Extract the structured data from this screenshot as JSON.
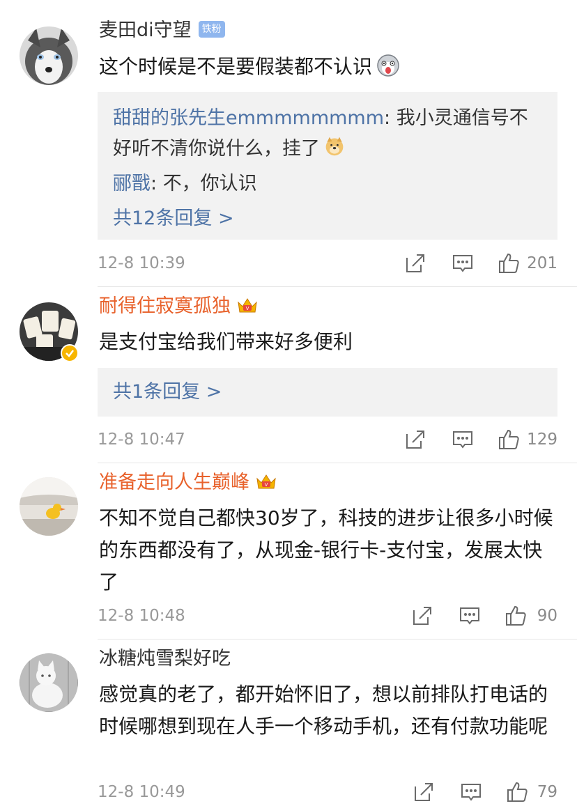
{
  "comments": [
    {
      "username": "麦田di守望",
      "fan_badge": "铁粉",
      "text": "这个时候是不是要假装都不认识",
      "emoji_icon": "husky-emoji-icon",
      "replies": [
        {
          "user": "甜甜的张先生emmmmmmmm",
          "sep": ": ",
          "text": "我小灵通信号不好听不清你说什么，挂了"
        },
        {
          "user": "郦戬",
          "sep": ": ",
          "text": "不，你认识"
        }
      ],
      "more_replies": "共12条回复 >",
      "time": "12-8 10:39",
      "likes": "201"
    },
    {
      "username": "耐得住寂寞孤独",
      "text": "是支付宝给我们带来好多便利",
      "more_replies": "共1条回复 >",
      "time": "12-8 10:47",
      "likes": "129"
    },
    {
      "username": "准备走向人生巅峰",
      "text": "不知不觉自己都快30岁了，科技的进步让很多小时候的东西都没有了，从现金-银行卡-支付宝，发展太快了",
      "time": "12-8 10:48",
      "likes": "90"
    },
    {
      "username": "冰糖炖雪梨好吃",
      "text": "感觉真的老了，都开始怀旧了，想以前排队打电话的时候哪想到现在人手一个移动手机，还有付款功能呢",
      "time": "12-8 10:49",
      "likes": "79"
    }
  ],
  "colors": {
    "reply_link": "#4e73a6",
    "vip_name": "#e8622c",
    "meta_gray": "#999999",
    "reply_bg": "#f2f2f2"
  },
  "icons": {
    "share": "share-icon",
    "comment": "comment-icon",
    "like": "thumbs-up-icon",
    "crown": "crown-icon",
    "verified": "verified-icon"
  }
}
